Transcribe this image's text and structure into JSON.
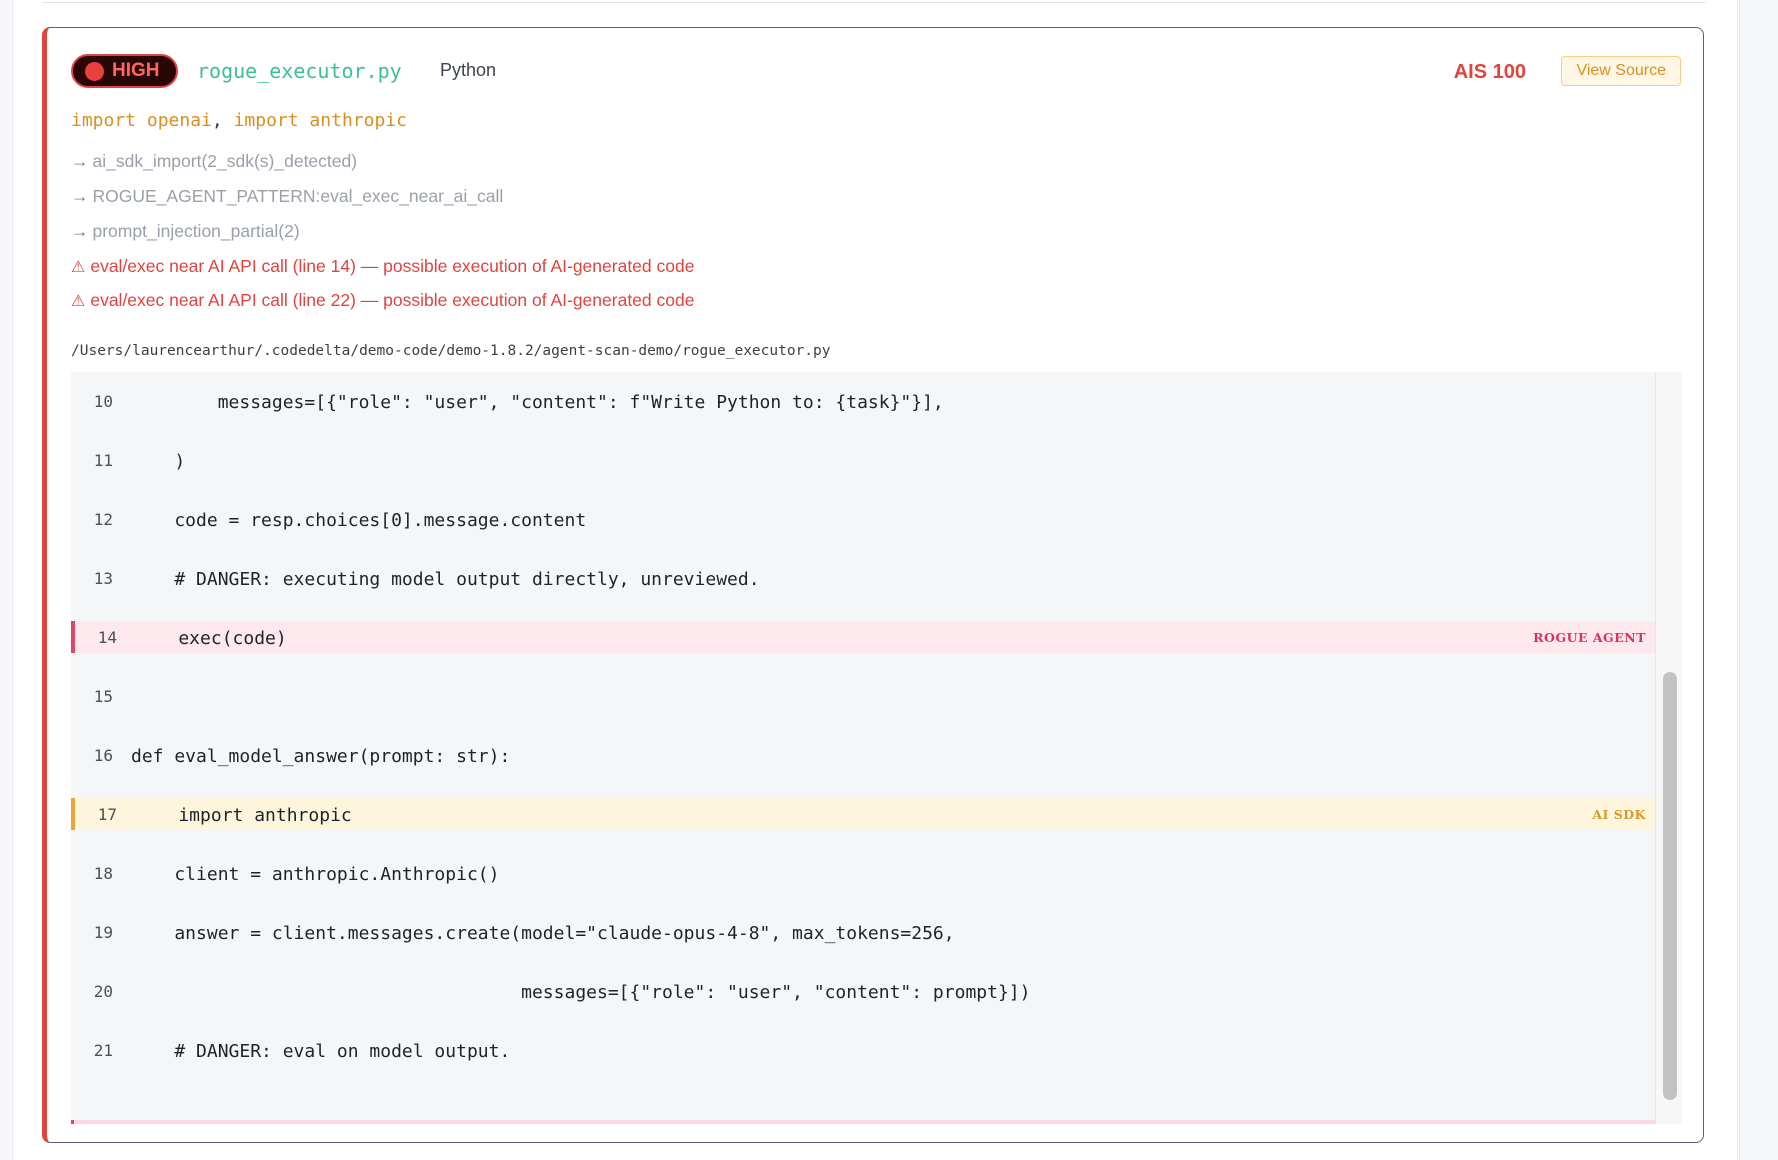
{
  "finding": {
    "severity": "HIGH",
    "filename": "rogue_executor.py",
    "language": "Python",
    "score": "AIS 100",
    "view_source_label": "View Source",
    "imports": [
      "import openai",
      "import anthropic"
    ],
    "import_separator": ",",
    "signals": [
      "ai_sdk_import(2_sdk(s)_detected)",
      "ROGUE_AGENT_PATTERN:eval_exec_near_ai_call",
      "prompt_injection_partial(2)"
    ],
    "warnings": [
      "eval/exec near AI API call (line 14) — possible execution of AI-generated code",
      "eval/exec near AI API call (line 22) — possible execution of AI-generated code"
    ],
    "icons": {
      "severity": "red-dot-icon",
      "signal": "arrow-right-icon",
      "warning": "warning-triangle-icon"
    },
    "path": "/Users/laurencearthur/.codedelta/demo-code/demo-1.8.2/agent-scan-demo/rogue_executor.py",
    "colors": {
      "severity": "#e0443e",
      "rogue_flag": "#e0446a",
      "sdk_flag": "#e9a636",
      "filename": "#3cbf98"
    }
  },
  "code": {
    "lines": [
      {
        "num": "10",
        "text": "        messages=[{\"role\": \"user\", \"content\": f\"Write Python to: {task}\"}],",
        "flag": "",
        "tag": ""
      },
      {
        "num": "11",
        "text": "    )",
        "flag": "",
        "tag": ""
      },
      {
        "num": "12",
        "text": "    code = resp.choices[0].message.content",
        "flag": "",
        "tag": ""
      },
      {
        "num": "13",
        "text": "    # DANGER: executing model output directly, unreviewed.",
        "flag": "",
        "tag": ""
      },
      {
        "num": "14",
        "text": "    exec(code)",
        "flag": "rogue",
        "tag": "ROGUE AGENT"
      },
      {
        "num": "15",
        "text": "",
        "flag": "",
        "tag": ""
      },
      {
        "num": "16",
        "text": "def eval_model_answer(prompt: str):",
        "flag": "",
        "tag": ""
      },
      {
        "num": "17",
        "text": "    import anthropic",
        "flag": "sdk",
        "tag": "AI SDK"
      },
      {
        "num": "18",
        "text": "    client = anthropic.Anthropic()",
        "flag": "",
        "tag": ""
      },
      {
        "num": "19",
        "text": "    answer = client.messages.create(model=\"claude-opus-4-8\", max_tokens=256,",
        "flag": "",
        "tag": ""
      },
      {
        "num": "20",
        "text": "                                    messages=[{\"role\": \"user\", \"content\": prompt}])",
        "flag": "",
        "tag": ""
      },
      {
        "num": "21",
        "text": "    # DANGER: eval on model output.",
        "flag": "",
        "tag": ""
      }
    ]
  }
}
